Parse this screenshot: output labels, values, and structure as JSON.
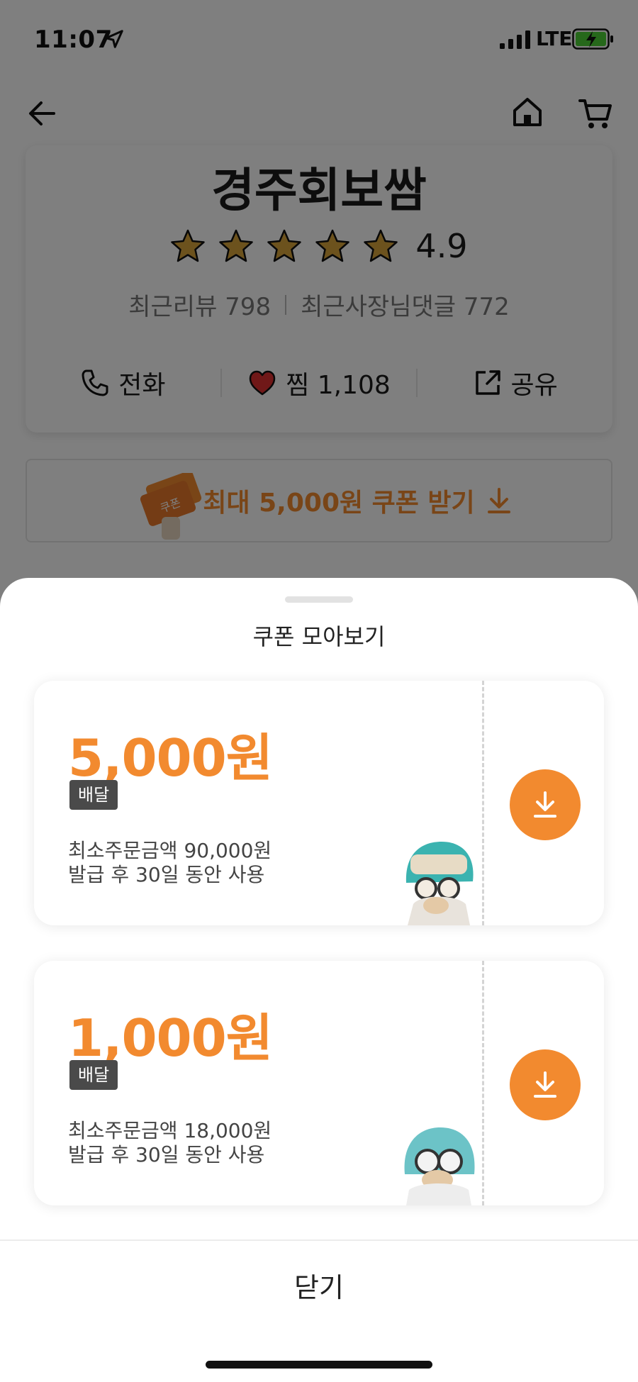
{
  "status_bar": {
    "time": "11:07",
    "network": "LTE"
  },
  "store": {
    "name": "경주회보쌈",
    "rating": "4.9",
    "stars_filled": 5,
    "reviews_text": "최근리뷰 798",
    "owner_replies_text": "최근사장님댓글 772",
    "actions": {
      "call": "전화",
      "like": "찜 1,108",
      "share": "공유"
    }
  },
  "coupon_banner": {
    "text": "최대 5,000원 쿠폰 받기",
    "illustration_label": "쿠폰"
  },
  "sheet": {
    "title": "쿠폰 모아보기",
    "coupons": [
      {
        "amount": "5,000원",
        "tag": "배달",
        "min_order": "최소주문금액 90,000원",
        "validity": "발급 후 30일 동안 사용"
      },
      {
        "amount": "1,000원",
        "tag": "배달",
        "min_order": "최소주문금액 18,000원",
        "validity": "발급 후 30일 동안 사용"
      }
    ],
    "close_label": "닫기"
  },
  "colors": {
    "accent": "#f28a2f",
    "tag_bg": "#4a4a4a",
    "star": "#d9a53a",
    "heart": "#e03131"
  }
}
